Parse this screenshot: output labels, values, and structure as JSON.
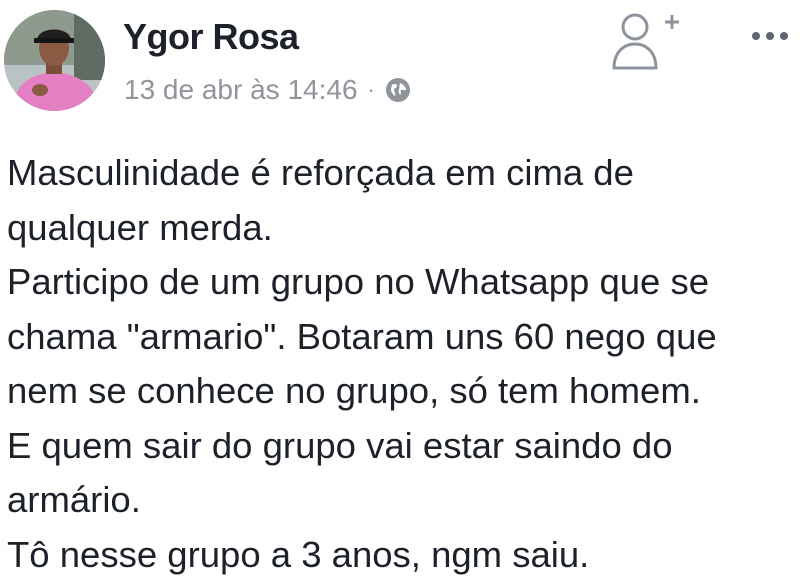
{
  "post": {
    "author": "Ygor Rosa",
    "timestamp": "13 de abr às 14:46",
    "separator": "·",
    "privacy_icon": "globe-icon",
    "add_friend_icon": "add-friend-icon",
    "more_icon": "more-options-icon",
    "avatar_icon": "profile-photo",
    "paragraphs": [
      "Masculinidade é reforçada em cima de\nqualquer merda.",
      "Participo de um grupo no Whatsapp que se\nchama \"armario\". Botaram uns 60 nego que\nnem se conhece no grupo, só tem homem.",
      "E quem sair do grupo vai estar saindo do\narmário.",
      "Tô nesse grupo a 3 anos, ngm saiu."
    ]
  },
  "colors": {
    "name": "#1d2129",
    "meta": "#90949c",
    "icon": "#8d949e",
    "text": "#1d2129"
  }
}
